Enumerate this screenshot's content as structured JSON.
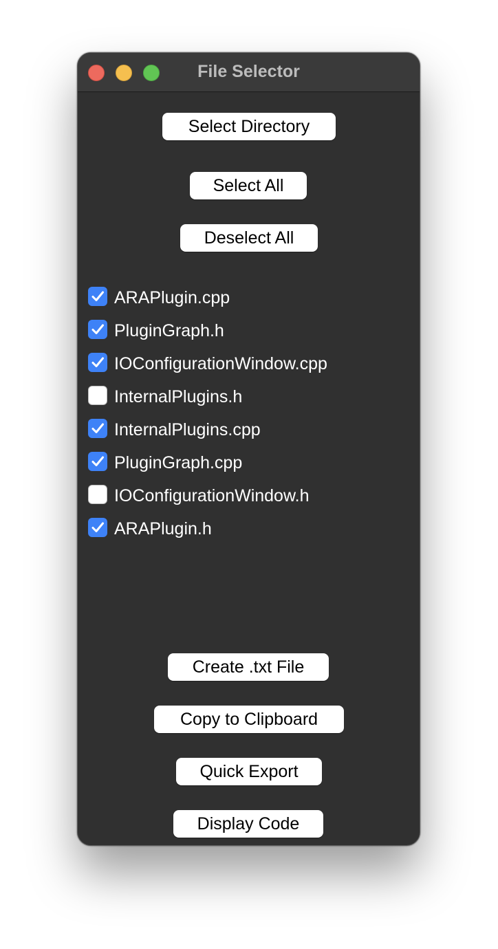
{
  "window": {
    "title": "File Selector"
  },
  "top_buttons": {
    "select_directory": "Select Directory",
    "select_all": "Select All",
    "deselect_all": "Deselect All"
  },
  "files": [
    {
      "name": "ARAPlugin.cpp",
      "checked": true
    },
    {
      "name": "PluginGraph.h",
      "checked": true
    },
    {
      "name": "IOConfigurationWindow.cpp",
      "checked": true
    },
    {
      "name": "InternalPlugins.h",
      "checked": false
    },
    {
      "name": "InternalPlugins.cpp",
      "checked": true
    },
    {
      "name": "PluginGraph.cpp",
      "checked": true
    },
    {
      "name": "IOConfigurationWindow.h",
      "checked": false
    },
    {
      "name": "ARAPlugin.h",
      "checked": true
    }
  ],
  "bottom_buttons": {
    "create_txt": "Create .txt File",
    "copy_clipboard": "Copy to Clipboard",
    "quick_export": "Quick Export",
    "display_code": "Display Code"
  },
  "colors": {
    "window_bg": "#303030",
    "titlebar_bg": "#3a3a3a",
    "checkbox_checked": "#3e82f7",
    "close": "#ed6a5e",
    "minimize": "#f5bf4f",
    "zoom": "#61c554"
  }
}
